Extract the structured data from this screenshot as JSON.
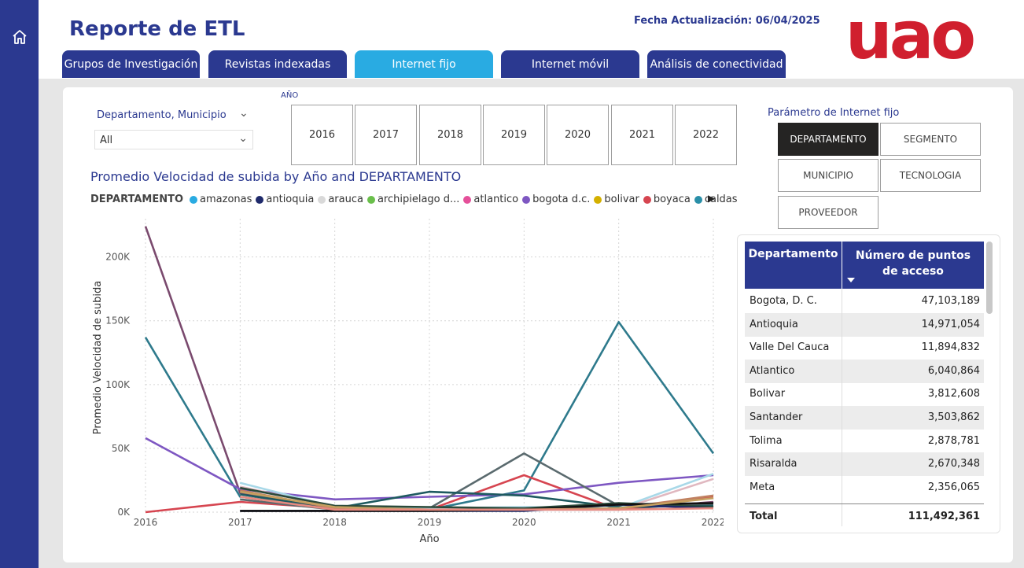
{
  "header": {
    "title": "Reporte de ETL",
    "update_label": "Fecha Actualización: 06/04/2025",
    "logo_text": "uao"
  },
  "tabs": [
    {
      "label": "Grupos de Investigación",
      "active": false
    },
    {
      "label": "Revistas indexadas",
      "active": false
    },
    {
      "label": "Internet fijo",
      "active": true
    },
    {
      "label": "Internet móvil",
      "active": false
    },
    {
      "label": "Análisis de conectividad",
      "active": false
    }
  ],
  "filter": {
    "label": "Departamento, Municipio",
    "value": "All"
  },
  "year_slicer": {
    "label": "AÑO",
    "years": [
      "2016",
      "2017",
      "2018",
      "2019",
      "2020",
      "2021",
      "2022"
    ]
  },
  "parameter": {
    "label": "Parámetro de Internet fijo",
    "options": [
      {
        "label": "DEPARTAMENTO",
        "active": true
      },
      {
        "label": "SEGMENTO",
        "active": false
      },
      {
        "label": "MUNICIPIO",
        "active": false
      },
      {
        "label": "TECNOLOGIA",
        "active": false
      },
      {
        "label": "PROVEEDOR",
        "active": false
      }
    ]
  },
  "chart_data": {
    "type": "line",
    "title": "Promedio Velocidad de subida by Año and DEPARTAMENTO",
    "xlabel": "Año",
    "ylabel": "Promedio Velocidad de subida",
    "legend_title": "DEPARTAMENTO",
    "legend_placement": "top-left",
    "legend": [
      {
        "name": "amazonas",
        "color": "#29abe2"
      },
      {
        "name": "antioquia",
        "color": "#1f2a6b"
      },
      {
        "name": "arauca",
        "color": "#d9d9d9"
      },
      {
        "name": "archipielago d...",
        "color": "#6abf4b"
      },
      {
        "name": "atlantico",
        "color": "#e5509a"
      },
      {
        "name": "bogota d.c.",
        "color": "#7e57c2"
      },
      {
        "name": "bolivar",
        "color": "#d4b000"
      },
      {
        "name": "boyaca",
        "color": "#d64550"
      },
      {
        "name": "caldas",
        "color": "#2a8fa8"
      }
    ],
    "x": [
      2016,
      2017,
      2018,
      2019,
      2020,
      2021,
      2022
    ],
    "yticks": [
      "0K",
      "50K",
      "100K",
      "150K",
      "200K"
    ],
    "ylim": [
      0,
      230000
    ],
    "grid": true,
    "series": [
      {
        "color": "#7a4a6e",
        "values": [
          224000,
          15000,
          3000,
          2000,
          2000,
          2000,
          8000
        ]
      },
      {
        "color": "#2e7a8c",
        "values": [
          137000,
          12000,
          3000,
          2000,
          17000,
          149000,
          46000
        ]
      },
      {
        "color": "#d64550",
        "values": [
          0,
          8000,
          3000,
          2000,
          29000,
          2000,
          12000
        ]
      },
      {
        "color": "#7e57c2",
        "values": [
          58000,
          18000,
          10000,
          12000,
          14000,
          23000,
          29000
        ]
      },
      {
        "color": "#5a6a6e",
        "values": [
          null,
          10000,
          2000,
          3000,
          46000,
          5000,
          6000
        ]
      },
      {
        "color": "#1e5a60",
        "values": [
          null,
          14000,
          3000,
          16000,
          13000,
          4000,
          5000
        ]
      },
      {
        "color": "#a8d8e8",
        "values": [
          null,
          23000,
          4000,
          3000,
          4000,
          3000,
          30000
        ]
      },
      {
        "color": "#e0b8c0",
        "values": [
          null,
          20000,
          4000,
          2000,
          3000,
          2000,
          26000
        ]
      },
      {
        "color": "#2b4a3a",
        "values": [
          null,
          19000,
          5000,
          4000,
          3000,
          7000,
          4000
        ]
      },
      {
        "color": "#c08060",
        "values": [
          null,
          17000,
          3000,
          2000,
          2000,
          3000,
          13000
        ]
      },
      {
        "color": "#1f2a6b",
        "values": [
          null,
          1000,
          1000,
          1000,
          1000,
          6000,
          3000
        ]
      },
      {
        "color": "#111111",
        "values": [
          null,
          1000,
          1000,
          1000,
          2000,
          6000,
          7000
        ]
      },
      {
        "color": "#c5a060",
        "values": [
          null,
          16000,
          4000,
          2000,
          2000,
          3000,
          11000
        ]
      },
      {
        "color": "#e88a80",
        "values": [
          null,
          12000,
          2000,
          2000,
          2000,
          2000,
          3000
        ]
      }
    ]
  },
  "table": {
    "headers": [
      "Departamento",
      "Número de puntos de acceso"
    ],
    "rows": [
      [
        "Bogota, D. C.",
        "47,103,189"
      ],
      [
        "Antioquia",
        "14,971,054"
      ],
      [
        "Valle Del Cauca",
        "11,894,832"
      ],
      [
        "Atlantico",
        "6,040,864"
      ],
      [
        "Bolivar",
        "3,812,608"
      ],
      [
        "Santander",
        "3,503,862"
      ],
      [
        "Tolima",
        "2,878,781"
      ],
      [
        "Risaralda",
        "2,670,348"
      ],
      [
        "Meta",
        "2,356,065"
      ]
    ],
    "total_label": "Total",
    "total_value": "111,492,361"
  }
}
